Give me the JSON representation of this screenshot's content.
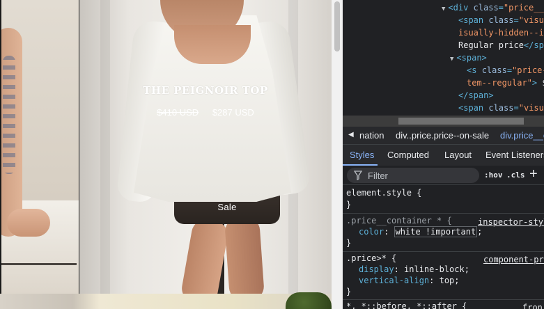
{
  "product": {
    "title": "THE PEIGNOIR TOP",
    "price_original": "$410 USD",
    "price_sale": "$287 USD",
    "badge": "Sale"
  },
  "devtools": {
    "dom_lines": [
      {
        "arrow": "▼",
        "parts": [
          {
            "c": "tag",
            "t": "<div "
          },
          {
            "c": "attr",
            "t": "class"
          },
          {
            "c": "tag",
            "t": "="
          },
          {
            "c": "attrv",
            "t": "\"price__"
          }
        ]
      },
      {
        "arrow": "",
        "parts": [
          {
            "c": "tag",
            "t": "<span "
          },
          {
            "c": "attr",
            "t": "class"
          },
          {
            "c": "tag",
            "t": "="
          },
          {
            "c": "attrv",
            "t": "\"visu"
          }
        ]
      },
      {
        "arrow": "",
        "parts": [
          {
            "c": "attrv",
            "t": "isually-hidden--in"
          }
        ]
      },
      {
        "arrow": "",
        "parts": [
          {
            "c": "txt",
            "t": "Regular price"
          },
          {
            "c": "tag",
            "t": "</span>"
          }
        ]
      },
      {
        "arrow": "▼",
        "parts": [
          {
            "c": "tag",
            "t": "<span>"
          }
        ]
      },
      {
        "arrow": "",
        "parts": [
          {
            "c": "tag",
            "t": "<s "
          },
          {
            "c": "attr",
            "t": "class"
          },
          {
            "c": "tag",
            "t": "="
          },
          {
            "c": "attrv",
            "t": "\"price-"
          }
        ]
      },
      {
        "arrow": "",
        "parts": [
          {
            "c": "attrv",
            "t": "tem--regular\""
          },
          {
            "c": "tag",
            "t": "> "
          },
          {
            "c": "txt",
            "t": "$"
          }
        ]
      },
      {
        "arrow": "",
        "parts": [
          {
            "c": "tag",
            "t": "</span>"
          }
        ]
      },
      {
        "arrow": "",
        "parts": [
          {
            "c": "tag",
            "t": "<span "
          },
          {
            "c": "attr",
            "t": "class"
          },
          {
            "c": "tag",
            "t": "="
          },
          {
            "c": "attrv",
            "t": "\"visu"
          }
        ]
      }
    ],
    "breadcrumbs": [
      "nation",
      "div..price.price--on-sale",
      "div.price__c"
    ],
    "tabs": [
      "Styles",
      "Computed",
      "Layout",
      "Event Listeners"
    ],
    "filter_placeholder": "Filter",
    "hov_label": ":hov",
    "cls_label": ".cls",
    "plus_label": "+",
    "rules": {
      "element_style": {
        "selector": "element.style {",
        "close": "}"
      },
      "price_container": {
        "selector": ".price__container * {",
        "source": "inspector-styl",
        "prop": "color",
        "value": "white !important",
        "close": "}"
      },
      "price": {
        "selector": ".price>* {",
        "source": "component-pri",
        "decl1_prop": "display",
        "decl1_value": "inline-block;",
        "decl2_prop": "vertical-align",
        "decl2_value": "top;",
        "close": "}"
      },
      "universal": {
        "selector": "*, *::before, *::after {",
        "source": "fron"
      }
    },
    "colors": {
      "background": "#202124",
      "tag": "#5db0d7",
      "attr_value": "#f29766",
      "active_tab": "#8ab4f8"
    }
  }
}
